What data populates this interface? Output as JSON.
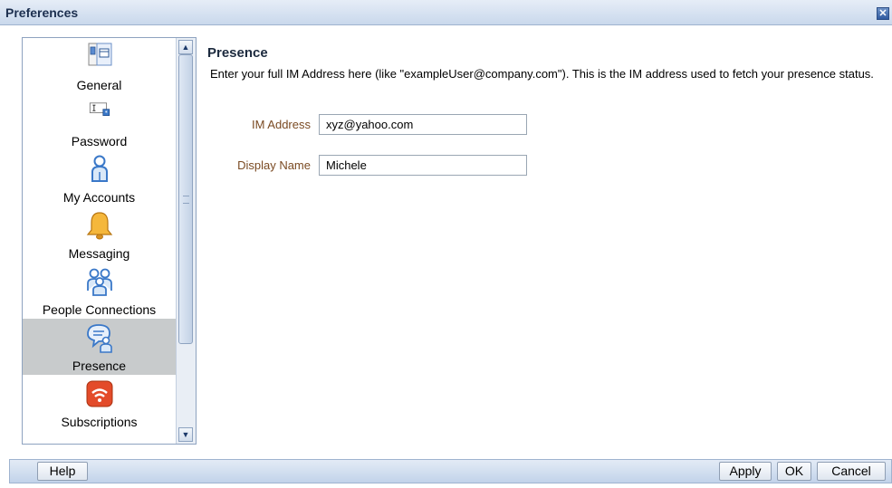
{
  "window": {
    "title": "Preferences",
    "close_icon": "close-icon"
  },
  "sidebar": {
    "items": [
      {
        "label": "General",
        "icon": "general-settings-icon"
      },
      {
        "label": "Password",
        "icon": "password-field-icon"
      },
      {
        "label": "My Accounts",
        "icon": "user-account-icon"
      },
      {
        "label": "Messaging",
        "icon": "bell-icon"
      },
      {
        "label": "People Connections",
        "icon": "people-group-icon"
      },
      {
        "label": "Presence",
        "icon": "presence-chat-icon",
        "selected": true
      },
      {
        "label": "Subscriptions",
        "icon": "rss-feed-icon"
      }
    ]
  },
  "content": {
    "title": "Presence",
    "description": "Enter your full IM Address here (like \"exampleUser@company.com\"). This is the IM address used to fetch your presence status.",
    "fields": {
      "im_address": {
        "label": "IM Address",
        "value": "xyz@yahoo.com"
      },
      "display_name": {
        "label": "Display Name",
        "value": "Michele"
      }
    }
  },
  "footer": {
    "help_label": "Help",
    "apply_label": "Apply",
    "ok_label": "OK",
    "cancel_label": "Cancel"
  },
  "colors": {
    "selected_item_bg": "#c8cbcc",
    "field_label_color": "#7a4a22",
    "titlebar_bg": "#c9d8ec"
  }
}
